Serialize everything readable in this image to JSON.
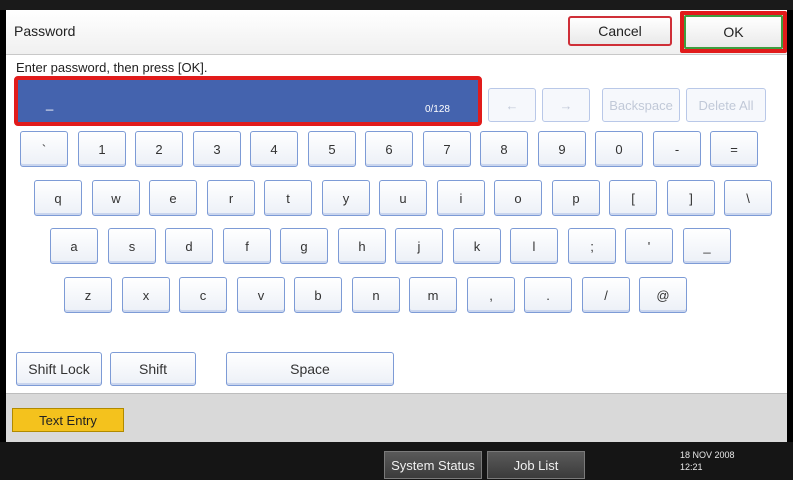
{
  "header": {
    "title": "Password",
    "cancel_label": "Cancel",
    "ok_label": "OK"
  },
  "instruction": "Enter password, then press [OK].",
  "password_field": {
    "value": "_",
    "counter": "0/128"
  },
  "edit_controls": {
    "left_arrow": "←",
    "right_arrow": "→",
    "backspace": "Backspace",
    "delete_all": "Delete All"
  },
  "keyboard": {
    "row1": [
      "`",
      "1",
      "2",
      "3",
      "4",
      "5",
      "6",
      "7",
      "8",
      "9",
      "0",
      "-",
      "="
    ],
    "row2": [
      "q",
      "w",
      "e",
      "r",
      "t",
      "y",
      "u",
      "i",
      "o",
      "p",
      "[",
      "]",
      "\\"
    ],
    "row3": [
      "a",
      "s",
      "d",
      "f",
      "g",
      "h",
      "j",
      "k",
      "l",
      ";",
      "'",
      "_"
    ],
    "row4": [
      "z",
      "x",
      "c",
      "v",
      "b",
      "n",
      "m",
      ",",
      ".",
      "/",
      "@"
    ]
  },
  "modifiers": {
    "shift_lock": "Shift Lock",
    "shift": "Shift",
    "space": "Space"
  },
  "tab": {
    "label": "Text Entry"
  },
  "statusbar": {
    "system_status": "System Status",
    "job_list": "Job List",
    "date": "18 NOV  2008",
    "time": "12:21"
  }
}
